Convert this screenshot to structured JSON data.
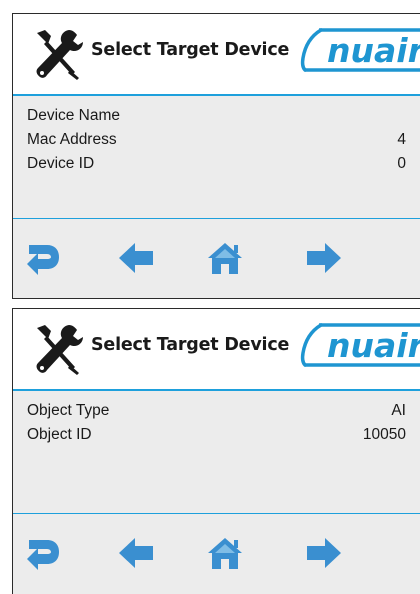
{
  "screens": [
    {
      "header": {
        "title": "Select Target Device",
        "logo": "nuaire"
      },
      "rows": [
        {
          "label": "Device Name",
          "value": ""
        },
        {
          "label": "Mac Address",
          "value": "4"
        },
        {
          "label": "Device ID",
          "value": "0"
        }
      ],
      "nav": [
        "return-icon",
        "arrow-left-icon",
        "home-icon",
        "arrow-right-icon"
      ]
    },
    {
      "header": {
        "title": "Select Target Device",
        "logo": "nuaire"
      },
      "rows": [
        {
          "label": "Object Type",
          "value": "AI"
        },
        {
          "label": "Object ID",
          "value": "10050"
        }
      ],
      "nav": [
        "return-icon",
        "arrow-left-icon",
        "home-icon",
        "arrow-right-icon"
      ]
    }
  ],
  "colors": {
    "accent": "#1ea0dc",
    "icon_blue": "#3a8fd0",
    "content_bg": "#ececec"
  }
}
